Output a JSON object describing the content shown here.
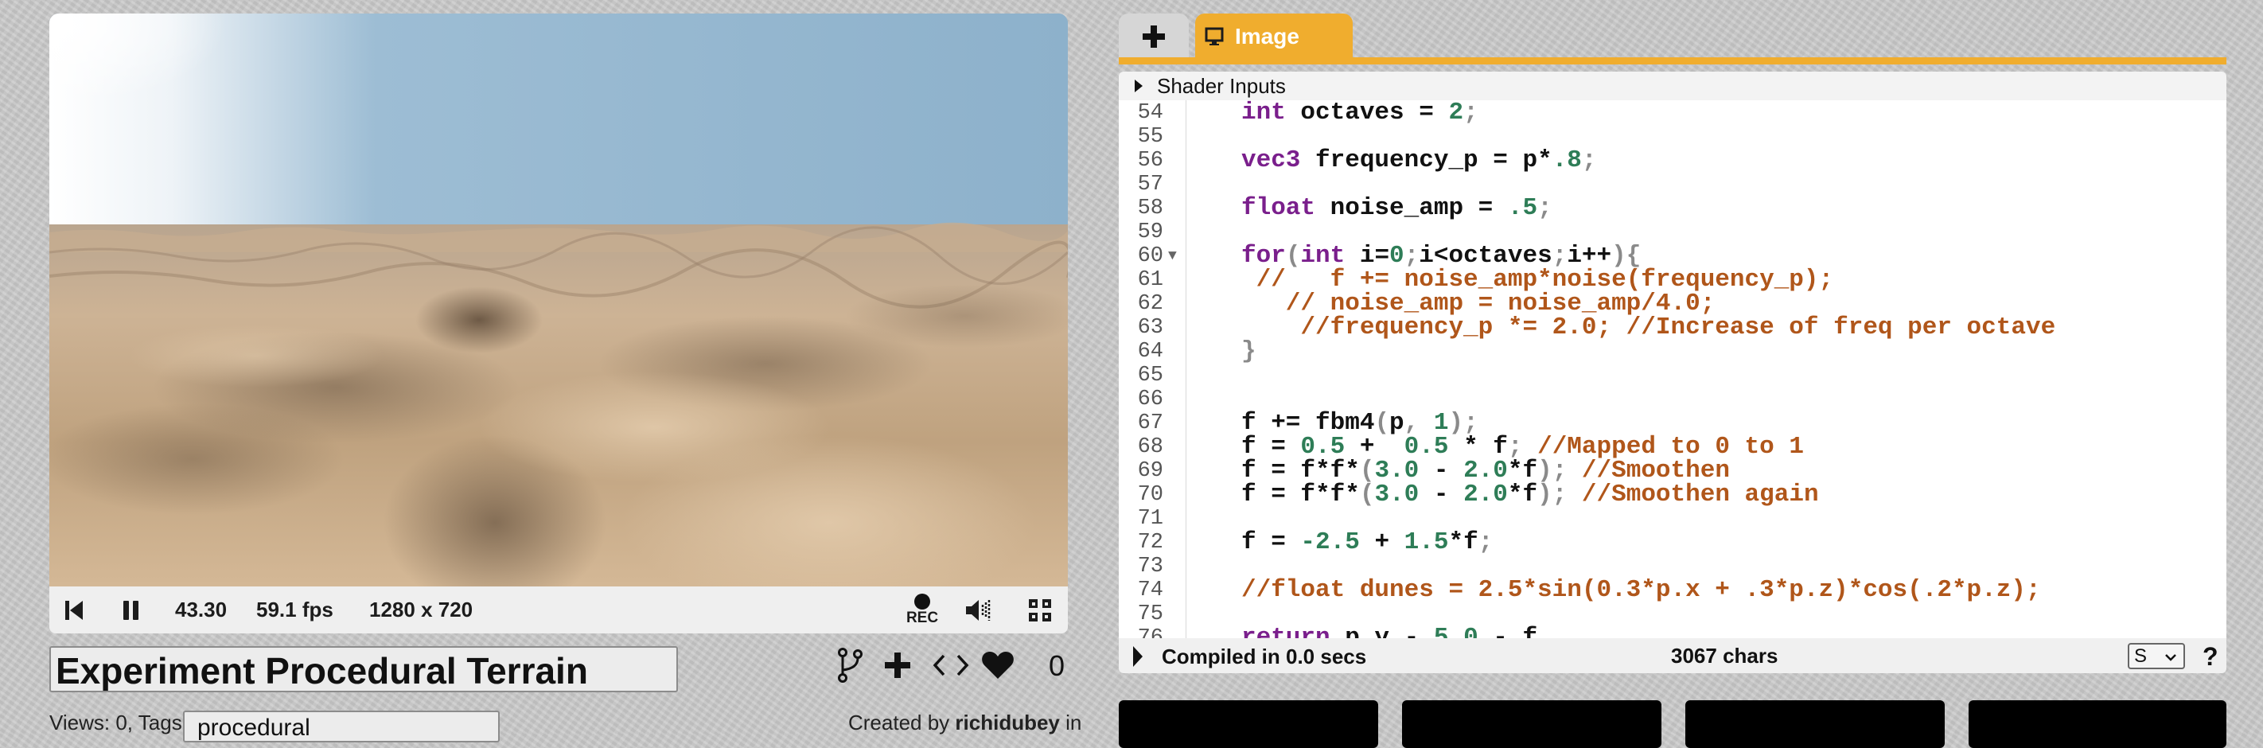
{
  "player": {
    "time": "43.30",
    "fps": "59.1 fps",
    "resolution": "1280 x 720",
    "rec_label": "REC"
  },
  "shader": {
    "title": "Experiment Procedural Terrain",
    "likes": "0",
    "views_label": "Views: 0, Tags:",
    "tags_value": "procedural",
    "created_prefix": "Created by",
    "author": "richidubey",
    "created_suffix": "in"
  },
  "editor": {
    "tabs": [
      {
        "label": "+"
      },
      {
        "label": "Image"
      }
    ],
    "shader_inputs_label": "Shader Inputs",
    "lines": [
      {
        "n": "54",
        "tokens": [
          {
            "c": "t-kw",
            "t": "int"
          },
          {
            "c": "t-id",
            "t": " octaves = "
          },
          {
            "c": "t-num",
            "t": "2"
          },
          {
            "c": "t-punc",
            "t": ";"
          }
        ]
      },
      {
        "n": "55",
        "tokens": []
      },
      {
        "n": "56",
        "tokens": [
          {
            "c": "t-kw",
            "t": "vec3"
          },
          {
            "c": "t-id",
            "t": " frequency_p = p*"
          },
          {
            "c": "t-num",
            "t": ".8"
          },
          {
            "c": "t-punc",
            "t": ";"
          }
        ]
      },
      {
        "n": "57",
        "tokens": []
      },
      {
        "n": "58",
        "tokens": [
          {
            "c": "t-kw",
            "t": "float"
          },
          {
            "c": "t-id",
            "t": " noise_amp = "
          },
          {
            "c": "t-num",
            "t": ".5"
          },
          {
            "c": "t-punc",
            "t": ";"
          }
        ]
      },
      {
        "n": "59",
        "tokens": []
      },
      {
        "n": "60",
        "fold": "▼",
        "tokens": [
          {
            "c": "t-kw",
            "t": "for"
          },
          {
            "c": "t-punc",
            "t": "("
          },
          {
            "c": "t-kw",
            "t": "int"
          },
          {
            "c": "t-id",
            "t": " i="
          },
          {
            "c": "t-num",
            "t": "0"
          },
          {
            "c": "t-punc",
            "t": ";"
          },
          {
            "c": "t-id",
            "t": "i<octaves"
          },
          {
            "c": "t-punc",
            "t": ";"
          },
          {
            "c": "t-id",
            "t": "i++"
          },
          {
            "c": "t-punc",
            "t": "){"
          }
        ]
      },
      {
        "n": "61",
        "tokens": [
          {
            "c": "t-cmt",
            "t": " //   f += noise_amp*noise(frequency_p);"
          }
        ]
      },
      {
        "n": "62",
        "tokens": [
          {
            "c": "t-cmt",
            "t": "   // noise_amp = noise_amp/4.0;"
          }
        ]
      },
      {
        "n": "63",
        "tokens": [
          {
            "c": "t-cmt",
            "t": "    //frequency_p *= 2.0; //Increase of freq per octave"
          }
        ]
      },
      {
        "n": "64",
        "tokens": [
          {
            "c": "t-punc",
            "t": "}"
          }
        ]
      },
      {
        "n": "65",
        "tokens": []
      },
      {
        "n": "66",
        "tokens": []
      },
      {
        "n": "67",
        "tokens": [
          {
            "c": "t-id",
            "t": "f += fbm4"
          },
          {
            "c": "t-punc",
            "t": "("
          },
          {
            "c": "t-id",
            "t": "p"
          },
          {
            "c": "t-punc",
            "t": ", "
          },
          {
            "c": "t-num",
            "t": "1"
          },
          {
            "c": "t-punc",
            "t": ");"
          }
        ]
      },
      {
        "n": "68",
        "tokens": [
          {
            "c": "t-id",
            "t": "f = "
          },
          {
            "c": "t-num",
            "t": "0.5"
          },
          {
            "c": "t-id",
            "t": " +  "
          },
          {
            "c": "t-num",
            "t": "0.5"
          },
          {
            "c": "t-id",
            "t": " * f"
          },
          {
            "c": "t-punc",
            "t": ";"
          },
          {
            "c": "t-cmt",
            "t": " //Mapped to 0 to 1"
          }
        ]
      },
      {
        "n": "69",
        "tokens": [
          {
            "c": "t-id",
            "t": "f = f*f*"
          },
          {
            "c": "t-punc",
            "t": "("
          },
          {
            "c": "t-num",
            "t": "3.0"
          },
          {
            "c": "t-id",
            "t": " - "
          },
          {
            "c": "t-num",
            "t": "2.0"
          },
          {
            "c": "t-id",
            "t": "*f"
          },
          {
            "c": "t-punc",
            "t": ");"
          },
          {
            "c": "t-cmt",
            "t": " //Smoothen"
          }
        ]
      },
      {
        "n": "70",
        "tokens": [
          {
            "c": "t-id",
            "t": "f = f*f*"
          },
          {
            "c": "t-punc",
            "t": "("
          },
          {
            "c": "t-num",
            "t": "3.0"
          },
          {
            "c": "t-id",
            "t": " - "
          },
          {
            "c": "t-num",
            "t": "2.0"
          },
          {
            "c": "t-id",
            "t": "*f"
          },
          {
            "c": "t-punc",
            "t": ");"
          },
          {
            "c": "t-cmt",
            "t": " //Smoothen again"
          }
        ]
      },
      {
        "n": "71",
        "tokens": []
      },
      {
        "n": "72",
        "tokens": [
          {
            "c": "t-id",
            "t": "f = "
          },
          {
            "c": "t-num",
            "t": "-2.5"
          },
          {
            "c": "t-id",
            "t": " + "
          },
          {
            "c": "t-num",
            "t": "1.5"
          },
          {
            "c": "t-id",
            "t": "*f"
          },
          {
            "c": "t-punc",
            "t": ";"
          }
        ]
      },
      {
        "n": "73",
        "tokens": []
      },
      {
        "n": "74",
        "tokens": [
          {
            "c": "t-cmt",
            "t": "//float dunes = 2.5*sin(0.3*p.x + .3*p.z)*cos(.2*p.z);"
          }
        ]
      },
      {
        "n": "75",
        "tokens": []
      },
      {
        "n": "76",
        "tokens": [
          {
            "c": "t-kw",
            "t": "return"
          },
          {
            "c": "t-id",
            "t": " p.y - "
          },
          {
            "c": "t-num",
            "t": "5.0"
          },
          {
            "c": "t-id",
            "t": " - f"
          }
        ]
      }
    ],
    "compiled_text": "Compiled in 0.0 secs",
    "chars_text": "3067 chars",
    "select_value": "S",
    "help_label": "?"
  },
  "colors": {
    "accent": "#f0ad2e",
    "keyword": "#7a1f8c",
    "number": "#2e7d57",
    "comment": "#b0561a",
    "sky": "#8fb3cc",
    "sand": "#c9ae8e"
  }
}
